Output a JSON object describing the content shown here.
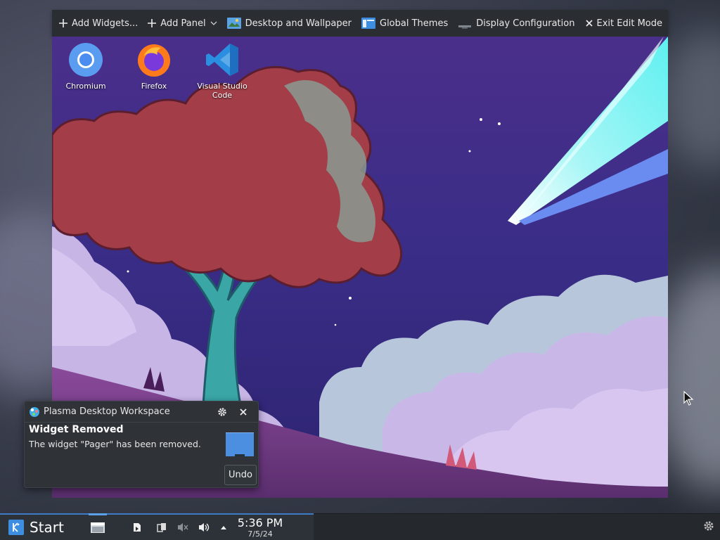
{
  "toolbar": {
    "add_widgets": "Add Widgets...",
    "add_panel": "Add Panel",
    "desktop_wallpaper": "Desktop and Wallpaper",
    "global_themes": "Global Themes",
    "display_configuration": "Display Configuration",
    "exit_edit_mode": "Exit Edit Mode"
  },
  "desktop_icons": [
    {
      "label": "Chromium",
      "icon": "chromium-icon"
    },
    {
      "label": "Firefox",
      "icon": "firefox-icon"
    },
    {
      "label": "Visual Studio\nCode",
      "label_line1": "Visual Studio",
      "label_line2": "Code",
      "icon": "vscode-icon"
    }
  ],
  "notification": {
    "app_name": "Plasma Desktop Workspace",
    "title": "Widget Removed",
    "body": "The widget \"Pager\" has been removed.",
    "undo_label": "Undo"
  },
  "taskbar": {
    "start_label": "Start",
    "time": "5:36 PM",
    "date": "7/5/24"
  },
  "colors": {
    "accent": "#3d8de0",
    "panel": "#25292e",
    "toolbar": "#2a2e32"
  }
}
